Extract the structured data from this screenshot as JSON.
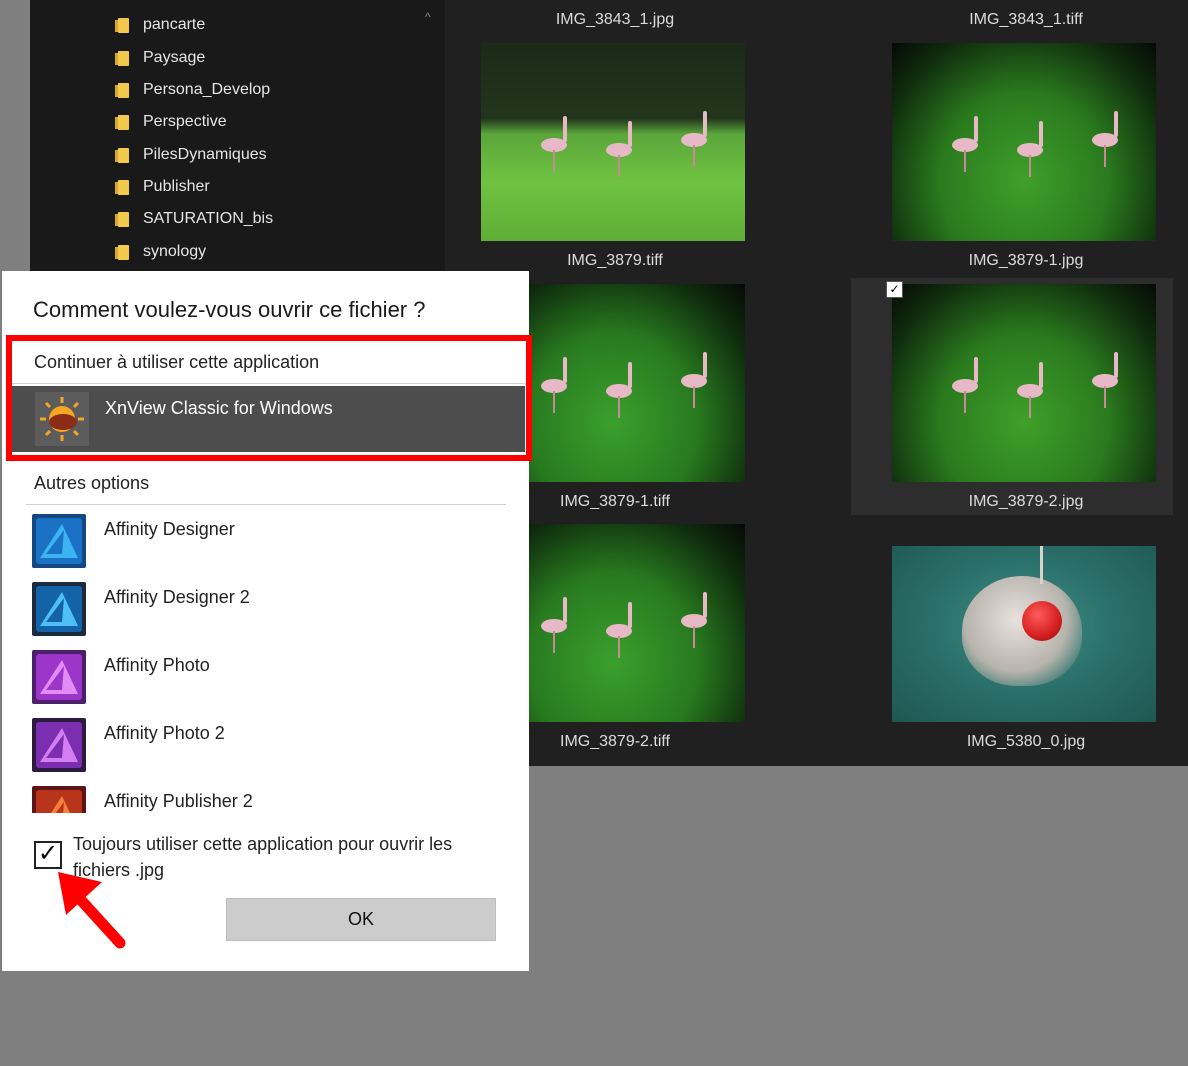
{
  "folders": [
    {
      "label": "pancarte"
    },
    {
      "label": "Paysage"
    },
    {
      "label": "Persona_Develop"
    },
    {
      "label": "Perspective"
    },
    {
      "label": "PilesDynamiques"
    },
    {
      "label": "Publisher"
    },
    {
      "label": "SATURATION_bis"
    },
    {
      "label": "synology"
    }
  ],
  "thumbnails": {
    "top_labels": [
      "IMG_3843_1.jpg",
      "IMG_3843_1.tiff"
    ],
    "items": [
      {
        "label": "IMG_3879.tiff"
      },
      {
        "label": "IMG_3879-1.jpg"
      },
      {
        "label": "IMG_3879-1.tiff"
      },
      {
        "label": "IMG_3879-2.jpg"
      },
      {
        "label": "IMG_3879-2.tiff"
      },
      {
        "label": "IMG_5380_0.jpg"
      }
    ]
  },
  "dialog": {
    "title": "Comment voulez-vous ouvrir ce fichier ?",
    "continue_heading": "Continuer à utiliser cette application",
    "current_app": "XnView Classic for Windows",
    "other_heading": "Autres options",
    "apps": [
      {
        "label": "Affinity Designer"
      },
      {
        "label": "Affinity Designer 2"
      },
      {
        "label": "Affinity Photo"
      },
      {
        "label": "Affinity Photo 2"
      },
      {
        "label": "Affinity Publisher 2"
      }
    ],
    "always_label": "Toujours utiliser cette application pour ouvrir les fichiers .jpg",
    "always_checked": true,
    "ok_label": "OK"
  },
  "colors": {
    "highlight": "#ff0000",
    "designer": "#1ba1e2",
    "photo": "#c159e6",
    "publisher": "#d9534f"
  }
}
